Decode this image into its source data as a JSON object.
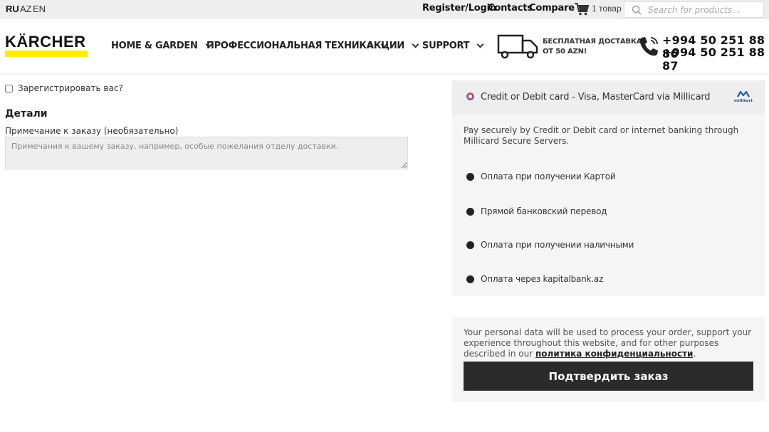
{
  "topbar": {
    "languages": [
      "RU",
      "AZ",
      "EN"
    ],
    "register_login": "Register/Login",
    "contacts": "Contacts",
    "compare": "Compare",
    "cart_count": "1 товар",
    "search_placeholder": "Search for products..."
  },
  "header": {
    "logo_text": "KÄRCHER",
    "nav": [
      "HOME & GARDEN",
      "ПРОФЕССИОНАЛЬНАЯ ТЕХНИКА",
      "АКЦИИ",
      "SUPPORT"
    ],
    "delivery_line1": "БЕСПЛАТНАЯ ДОСТАВКА",
    "delivery_line2": "ОТ 50 AZN!",
    "phone1": "+994 50 251 88 86",
    "phone2": "+994 50 251 88 87"
  },
  "form": {
    "register_label": "Зарегистрировать вас?",
    "details_title": "Детали",
    "note_label": "Примечание к заказу (необязательно)",
    "note_placeholder": "Примечания к вашему заказу, например, особые пожелания отделу доставки."
  },
  "payment": {
    "selected_method": "Credit or Debit card - Visa, MasterCard via Millicard",
    "selected_description": "Pay securely by Credit or Debit card or internet banking through Millicard Secure Servers.",
    "millikart_logo_text": "millikart",
    "options": [
      "Оплата при получении Картой",
      "Прямой банковский перевод",
      "Оплата при получении наличными",
      "Оплата через kapitalbank.az"
    ]
  },
  "confirm": {
    "privacy_text": "Your personal data will be used to process your order, support your experience throughout this website, and for other purposes described in our",
    "privacy_link": "политика конфиденциальности",
    "privacy_end": ".",
    "button_label": "Подтвердить заказ"
  },
  "colors": {
    "brand_yellow": "#ffed00",
    "radio_accent": "#9b5c8f",
    "button_dark": "#2b2b2b"
  }
}
